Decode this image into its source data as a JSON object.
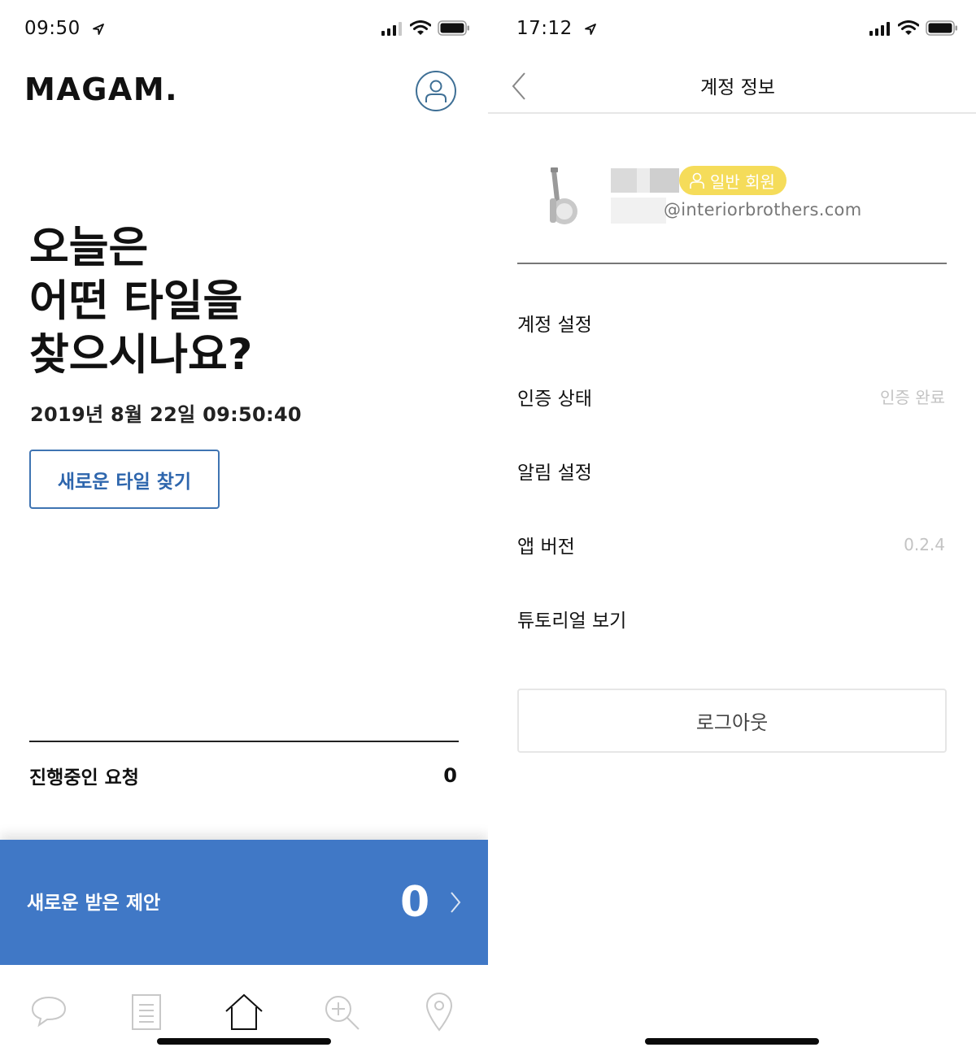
{
  "left_screen": {
    "status_bar": {
      "time": "09:50"
    },
    "app_logo": "MAGAM.",
    "hero_title": [
      "오늘은",
      "어떤 타일을",
      "찾으시나요?"
    ],
    "datetime": "2019년 8월 22일 09:50:40",
    "find_tile_button": "새로운 타일 찾기",
    "ongoing_requests": {
      "label": "진행중인 요청",
      "count": "0"
    },
    "new_offers": {
      "label": "새로운 받은 제안",
      "count": "0"
    },
    "tab_bar": {
      "items": [
        {
          "icon": "chat-bubble-icon",
          "active": false
        },
        {
          "icon": "document-icon",
          "active": false
        },
        {
          "icon": "home-icon",
          "active": true
        },
        {
          "icon": "search-add-icon",
          "active": false
        },
        {
          "icon": "location-pin-icon",
          "active": false
        }
      ]
    }
  },
  "right_screen": {
    "status_bar": {
      "time": "17:12"
    },
    "header_title": "계정 정보",
    "profile": {
      "member_badge": "일반 회원",
      "email_domain": "@interiorbrothers.com"
    },
    "settings": [
      {
        "label": "계정 설정",
        "value": ""
      },
      {
        "label": "인증 상태",
        "value": "인증 완료"
      },
      {
        "label": "알림 설정",
        "value": ""
      },
      {
        "label": "앱 버전",
        "value": "0.2.4"
      },
      {
        "label": "튜토리얼 보기",
        "value": ""
      }
    ],
    "logout_button": "로그아웃"
  },
  "colors": {
    "brand_blue": "#4078c6",
    "button_blue": "#2e66ad",
    "badge_yellow": "#f5dc5a",
    "muted_text": "#c3c3c3"
  }
}
